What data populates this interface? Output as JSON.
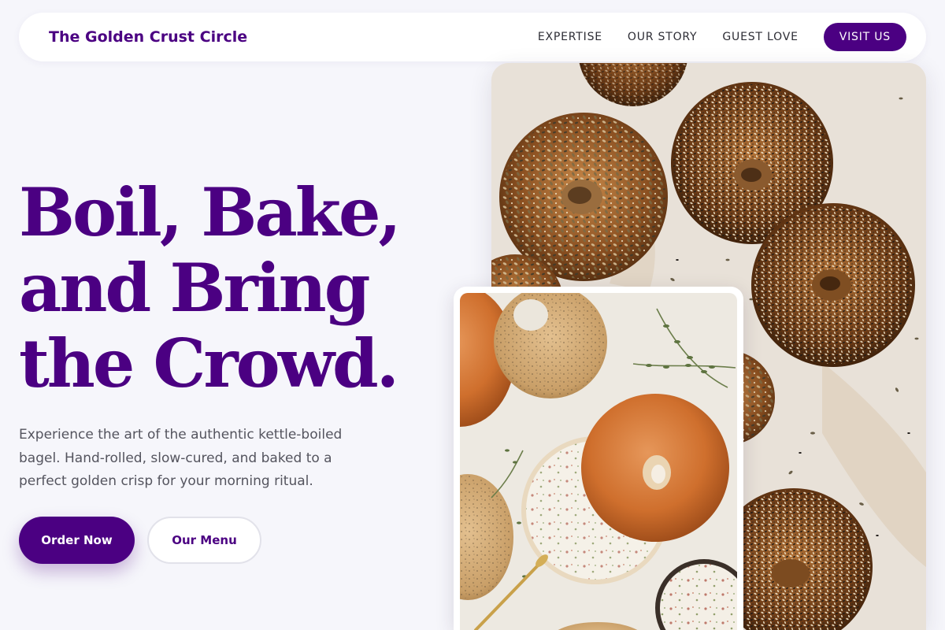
{
  "header": {
    "brand": "The Golden Crust Circle",
    "nav": [
      "EXPERTISE",
      "OUR STORY",
      "GUEST LOVE"
    ],
    "cta": "VISIT US"
  },
  "hero": {
    "title_lines": [
      "Boil, Bake,",
      "and Bring",
      "the Crowd."
    ],
    "description": "Experience the art of the authentic kettle-boiled bagel. Hand-rolled, slow-cured, and baked to a perfect golden crisp for your morning ritual.",
    "primary_button": "Order Now",
    "secondary_button": "Our Menu"
  },
  "images": {
    "main": "seeded bagels on parchment",
    "inset": "bagel with cream cheese and herbs"
  },
  "colors": {
    "accent": "#4b0082",
    "background": "#f6f6fb",
    "text": "#54545e"
  }
}
